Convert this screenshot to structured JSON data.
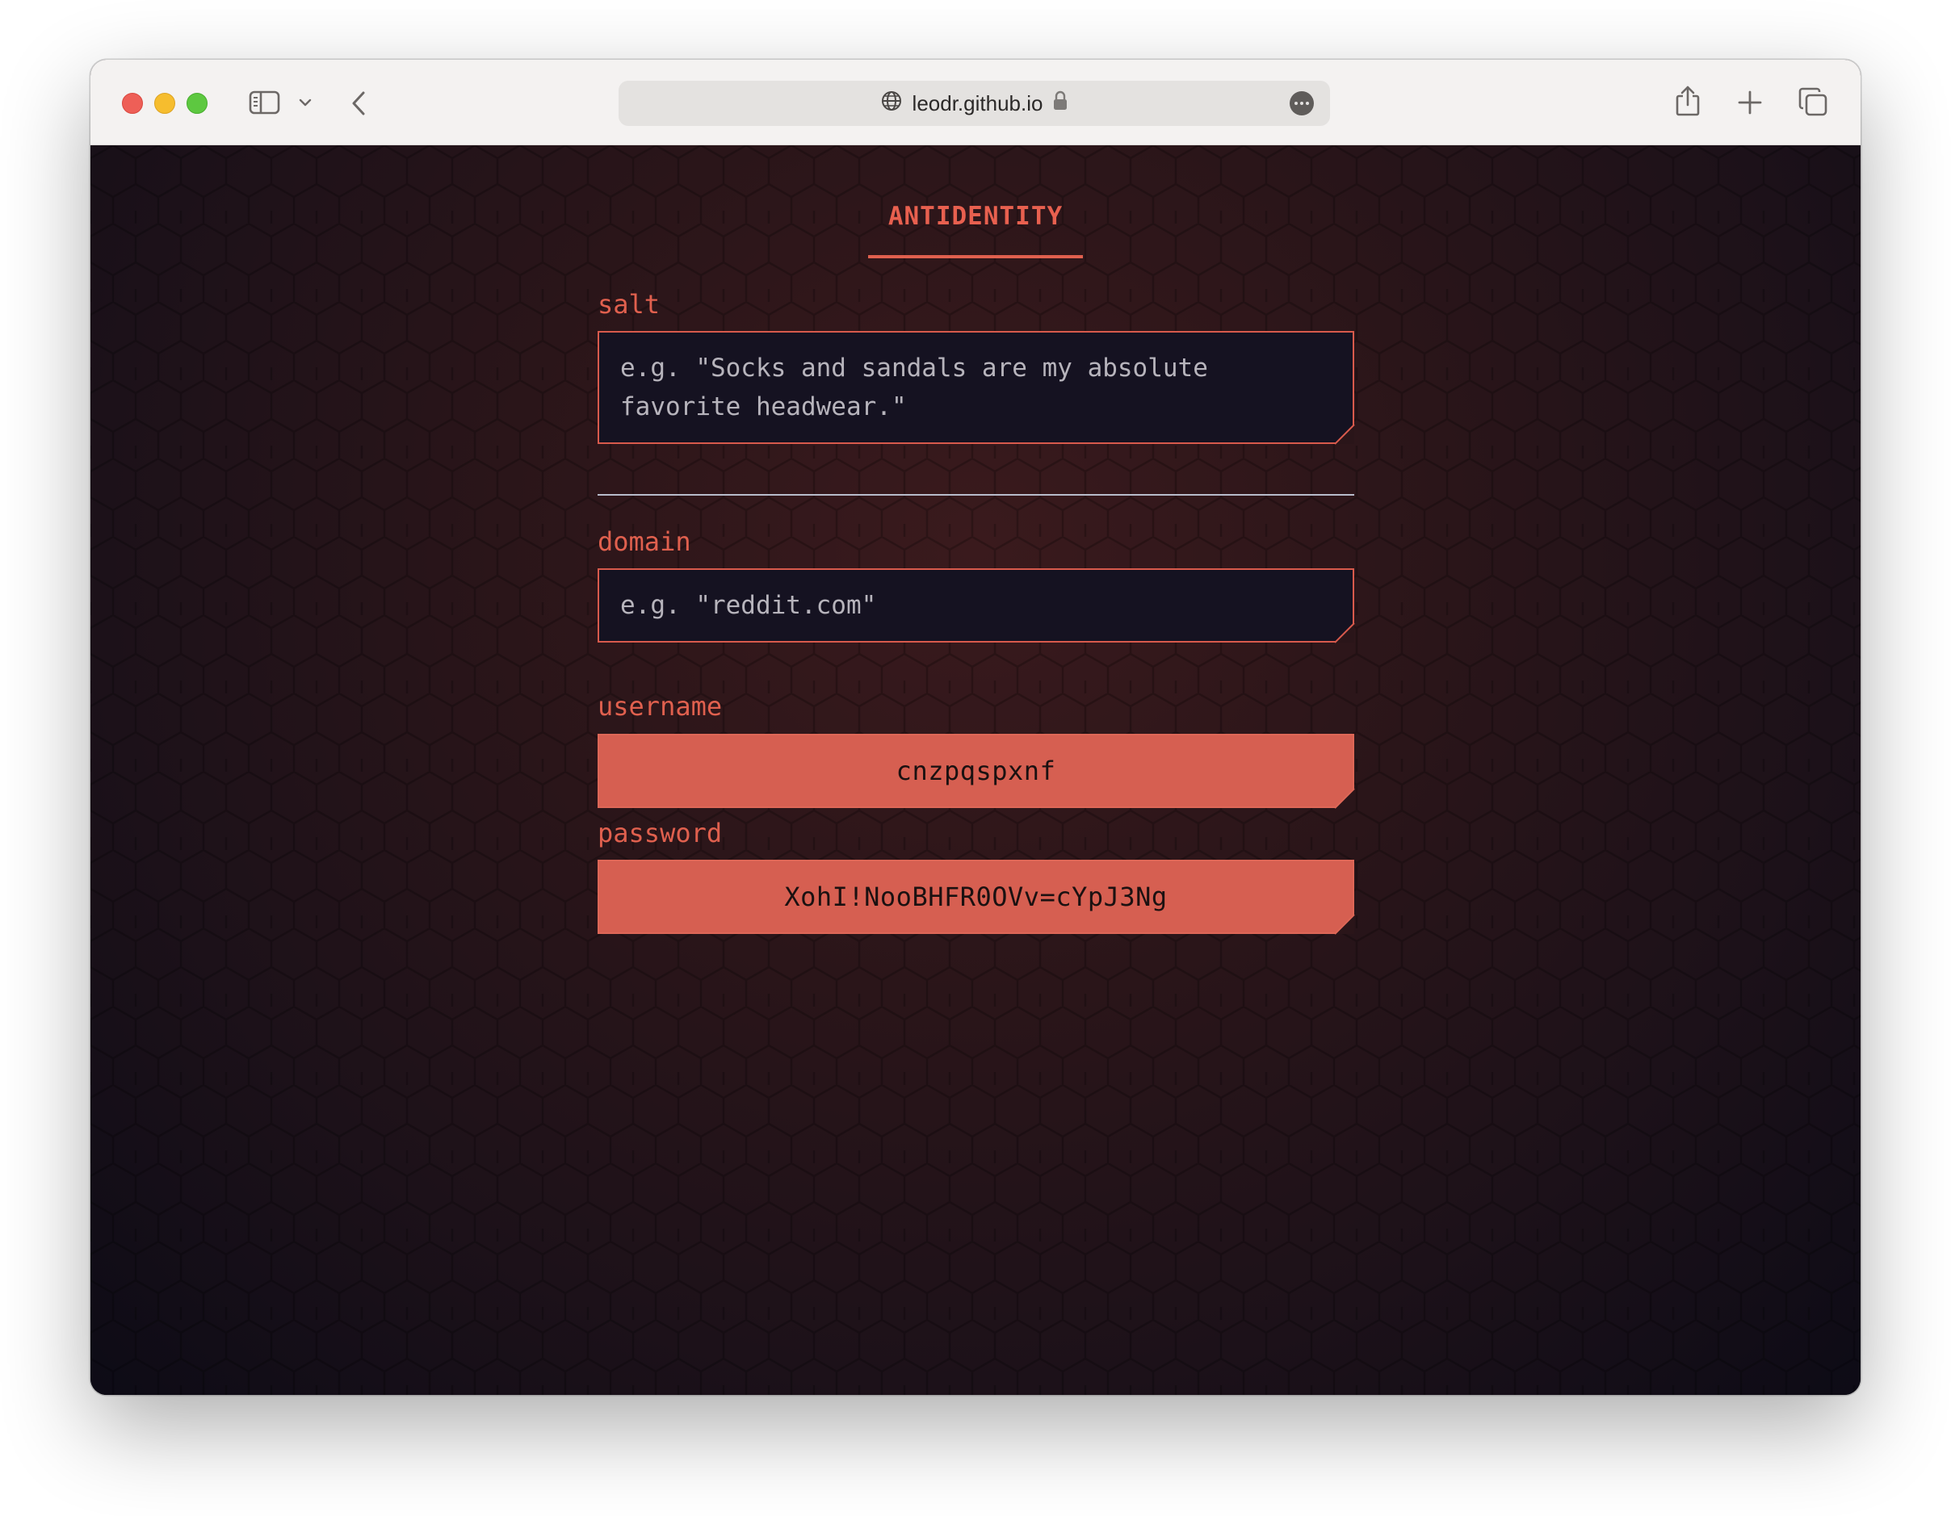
{
  "browser": {
    "url": "leodr.github.io"
  },
  "app": {
    "title": "ANTIDENTITY"
  },
  "form": {
    "salt": {
      "label": "salt",
      "placeholder": "e.g. \"Socks and sandals are my absolute favorite headwear.\"",
      "value": ""
    },
    "domain": {
      "label": "domain",
      "placeholder": "e.g. \"reddit.com\"",
      "value": ""
    }
  },
  "output": {
    "username": {
      "label": "username",
      "value": "cnzpqspxnf"
    },
    "password": {
      "label": "password",
      "value": "XohI!NooBHFR0OVv=cYpJ3Ng"
    }
  },
  "colors": {
    "accent": "#e0604e",
    "output_fill": "#d65f51",
    "field_bg": "#151221",
    "page_bg": "#2a1519"
  }
}
